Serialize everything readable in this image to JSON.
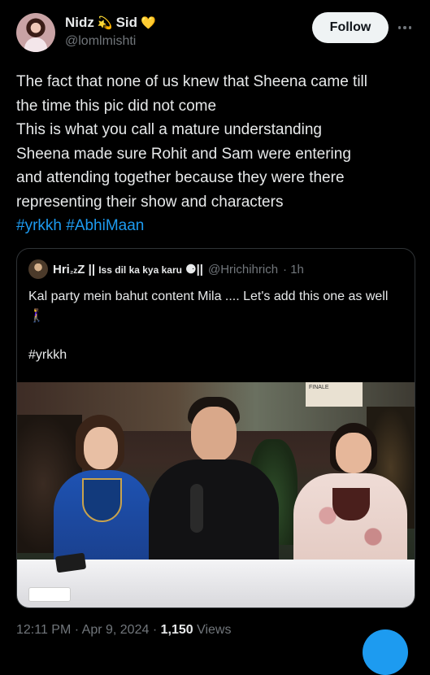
{
  "author": {
    "name_part1": "Nidz",
    "emoji1": "💫",
    "name_part2": "Sid",
    "emoji2": "💛",
    "handle": "@lomlmishti",
    "avatar_icon": "profile-avatar"
  },
  "follow_label": "Follow",
  "more_icon": "more-horizontal-icon",
  "tweet_lines": [
    "The fact that none of us knew that Sheena came till",
    "the time this pic did not come",
    "This is what you call a mature understanding",
    "Sheena made sure Rohit and Sam were entering",
    "and attending together because they were there",
    "representing their show and characters"
  ],
  "hashtags": [
    "#yrkkh",
    "#AbhiMaan"
  ],
  "quote": {
    "name_prefix": "Hri",
    "name_sleep": "₂z",
    "name_z": "Z",
    "name_sep": "||",
    "name_title": "Iss dil ka kya karu",
    "name_suffix": "⚈||",
    "handle": "@Hrichihrich",
    "time": "· 1h",
    "text": "Kal party mein bahut content Mila .... Let's add this one as well 🚶‍♀️",
    "tag": "#yrkkh",
    "image_caption_brand": "FINALE"
  },
  "meta": {
    "time": "12:11 PM",
    "sep1": " · ",
    "date": "Apr 9, 2024",
    "sep2": " · ",
    "views": "1,150",
    "views_label": " Views"
  },
  "colors": {
    "background": "#000000",
    "text": "#e7e9ea",
    "secondary": "#71767b",
    "accent": "#1d9bf0",
    "follow_bg": "#eff3f4"
  }
}
